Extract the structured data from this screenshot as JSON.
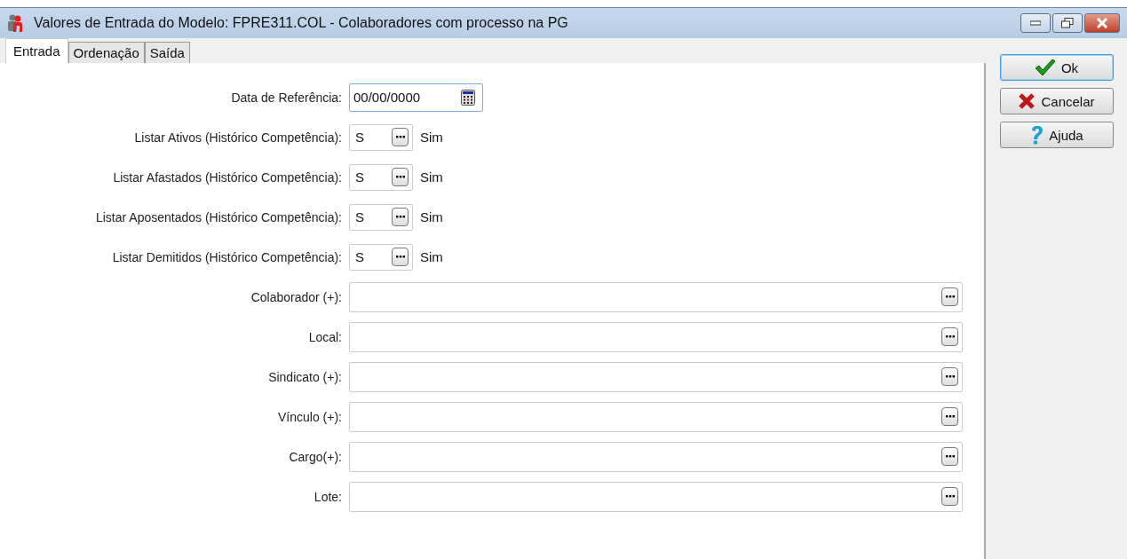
{
  "window": {
    "title": "Valores de Entrada do Modelo: FPRE311.COL - Colaboradores com processo na PG"
  },
  "tabs": [
    {
      "label": "Entrada",
      "selected": true
    },
    {
      "label": "Ordenação",
      "selected": false
    },
    {
      "label": "Saída",
      "selected": false
    }
  ],
  "fields": [
    {
      "kind": "date",
      "label": "Data de Referência:",
      "value": "00/00/0000",
      "focused": true
    },
    {
      "kind": "short",
      "label": "Listar Ativos (Histórico Competência):",
      "value": "S",
      "description": "Sim",
      "focused": false
    },
    {
      "kind": "short",
      "label": "Listar Afastados (Histórico Competência):",
      "value": "S",
      "description": "Sim",
      "focused": false
    },
    {
      "kind": "short",
      "label": "Listar Aposentados (Histórico Competência):",
      "value": "S",
      "description": "Sim",
      "focused": false
    },
    {
      "kind": "short",
      "label": "Listar Demitidos (Histórico Competência):",
      "value": "S",
      "description": "Sim",
      "focused": false
    },
    {
      "kind": "long",
      "label": "Colaborador (+):",
      "focused": false
    },
    {
      "kind": "long",
      "label": "Local:",
      "focused": false
    },
    {
      "kind": "long",
      "label": "Sindicato (+):",
      "focused": false
    },
    {
      "kind": "long",
      "label": "Vínculo (+):",
      "focused": false
    },
    {
      "kind": "long",
      "label": "Cargo(+):",
      "focused": false
    },
    {
      "kind": "long",
      "label": "Lote:",
      "focused": false
    }
  ],
  "buttons": [
    {
      "kind": "ok",
      "label": "Ok",
      "default": true
    },
    {
      "kind": "cancel",
      "label": "Cancelar",
      "default": false
    },
    {
      "kind": "help",
      "label": "Ajuda",
      "default": false
    }
  ]
}
